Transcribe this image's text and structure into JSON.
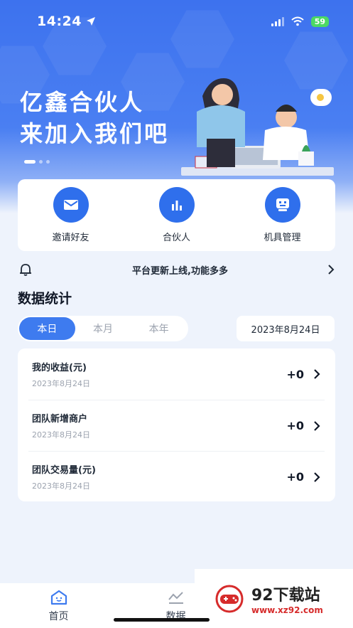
{
  "status_bar": {
    "time": "14:24",
    "battery": "59"
  },
  "banner": {
    "line1": "亿鑫合伙人",
    "line2": "来加入我们吧"
  },
  "quick_actions": [
    {
      "label": "邀请好友",
      "icon": "mail-icon"
    },
    {
      "label": "合伙人",
      "icon": "bar-chart-icon"
    },
    {
      "label": "机具管理",
      "icon": "robot-icon"
    }
  ],
  "notice": {
    "text": "平台更新上线,功能多多",
    "icon": "bell-icon"
  },
  "stats_section": {
    "title": "数据统计",
    "tabs": [
      "本日",
      "本月",
      "本年"
    ],
    "active_tab": "本日",
    "date": "2023年8月24日"
  },
  "stats": [
    {
      "label": "我的收益(元)",
      "date": "2023年8月24日",
      "value": "+0"
    },
    {
      "label": "团队新增商户",
      "date": "2023年8月24日",
      "value": "+0"
    },
    {
      "label": "团队交易量(元)",
      "date": "2023年8月24日",
      "value": "+0"
    }
  ],
  "tabbar": [
    {
      "label": "首页",
      "icon": "home-icon",
      "active": true
    },
    {
      "label": "数据",
      "icon": "chart-icon",
      "active": false
    }
  ],
  "watermark": {
    "title": "92下载站",
    "url": "www.xz92.com"
  },
  "colors": {
    "primary": "#3e7bef",
    "icon_bg": "#2f6fec",
    "background": "#eef3fc"
  }
}
